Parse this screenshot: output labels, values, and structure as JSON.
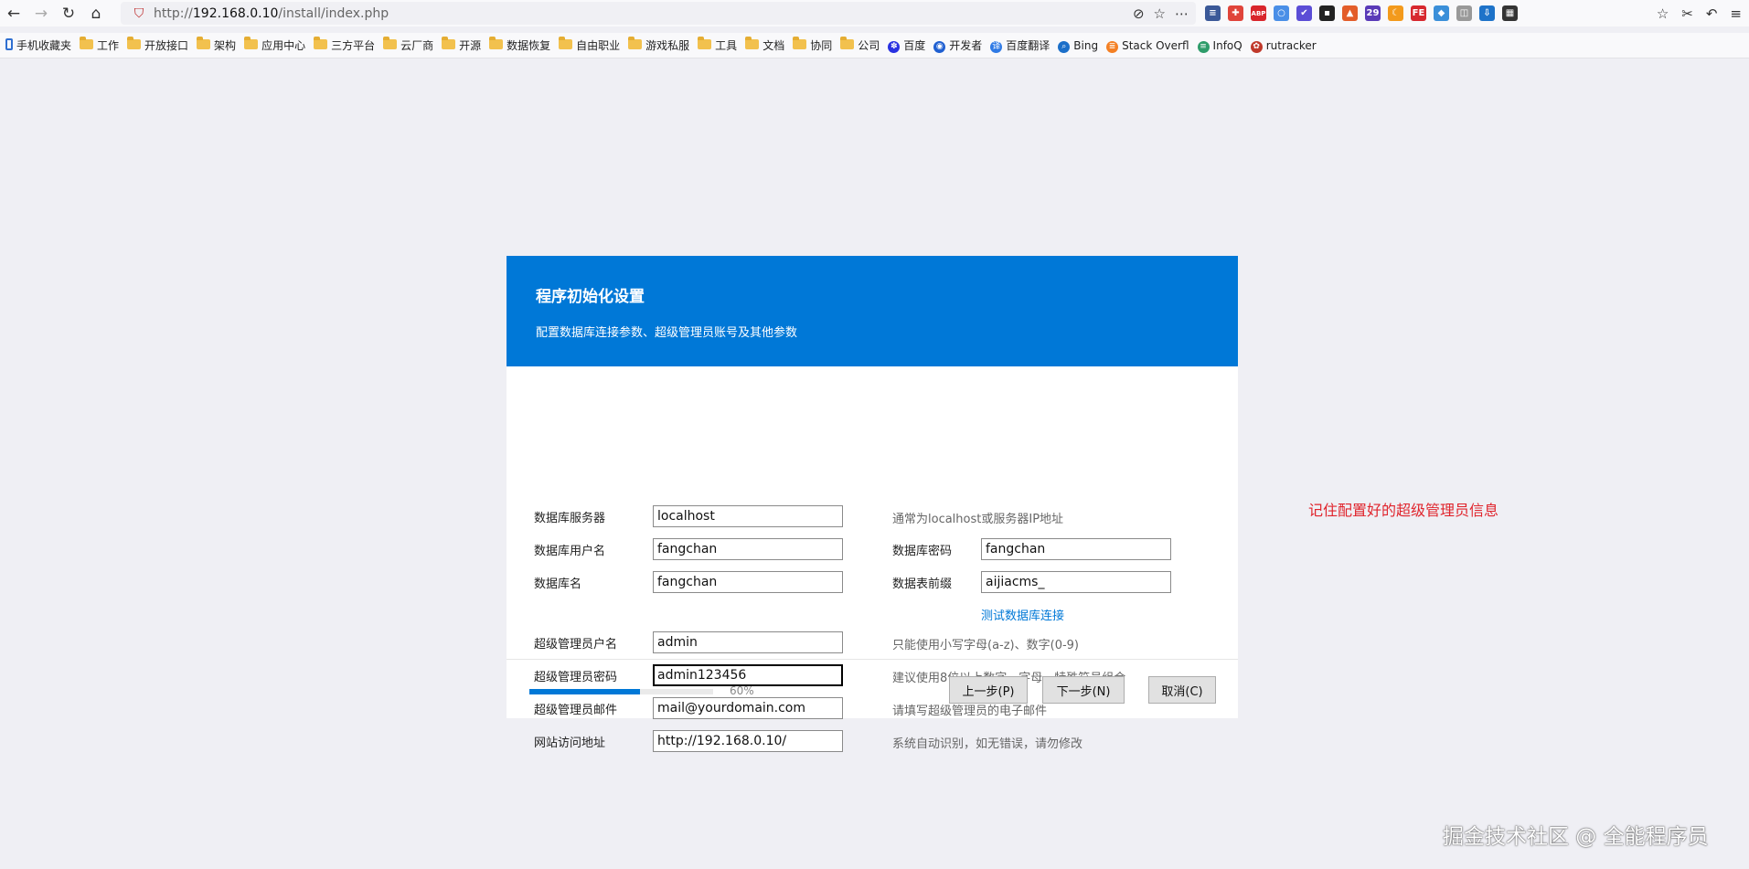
{
  "browser": {
    "url_prefix": "http://",
    "url_host": "192.168.0.10",
    "url_path": "/install/index.php",
    "extensions": [
      {
        "icon": "flag-icon",
        "color": "#3b5998",
        "glyph": "≡"
      },
      {
        "icon": "puzzle-icon",
        "color": "#e0443a",
        "glyph": "✚"
      },
      {
        "icon": "adblock-icon",
        "color": "#d9262c",
        "glyph": "ABP"
      },
      {
        "icon": "translate-icon",
        "color": "#4a8fe7",
        "glyph": "○"
      },
      {
        "icon": "check-icon",
        "color": "#5b4dd6",
        "glyph": "✔"
      },
      {
        "icon": "tool-icon",
        "color": "#222222",
        "glyph": "▪"
      },
      {
        "icon": "tree-icon",
        "color": "#e35d2a",
        "glyph": "▲"
      },
      {
        "icon": "badge-icon",
        "color": "#5a3ab8",
        "glyph": "29"
      },
      {
        "icon": "moon-icon",
        "color": "#f39a1c",
        "glyph": "☾"
      },
      {
        "icon": "fe-icon",
        "color": "#d7282f",
        "glyph": "FE"
      },
      {
        "icon": "shield-icon",
        "color": "#3a8fd9",
        "glyph": "◆"
      },
      {
        "icon": "reader-icon",
        "color": "#999999",
        "glyph": "◫"
      },
      {
        "icon": "save-icon",
        "color": "#1e73c9",
        "glyph": "⇩"
      },
      {
        "icon": "grid-icon",
        "color": "#333333",
        "glyph": "▦"
      }
    ]
  },
  "bookmarks": [
    {
      "label": "手机收藏夹",
      "icon": "phone-icon"
    },
    {
      "label": "工作",
      "icon": "folder-icon"
    },
    {
      "label": "开放接口",
      "icon": "folder-icon"
    },
    {
      "label": "架构",
      "icon": "folder-icon"
    },
    {
      "label": "应用中心",
      "icon": "folder-icon"
    },
    {
      "label": "三方平台",
      "icon": "folder-icon"
    },
    {
      "label": "云厂商",
      "icon": "folder-icon"
    },
    {
      "label": "开源",
      "icon": "folder-icon"
    },
    {
      "label": "数据恢复",
      "icon": "folder-icon"
    },
    {
      "label": "自由职业",
      "icon": "folder-icon"
    },
    {
      "label": "游戏私服",
      "icon": "folder-icon"
    },
    {
      "label": "工具",
      "icon": "folder-icon"
    },
    {
      "label": "文档",
      "icon": "folder-icon"
    },
    {
      "label": "协同",
      "icon": "folder-icon"
    },
    {
      "label": "公司",
      "icon": "folder-icon"
    },
    {
      "label": "百度",
      "icon": "baidu-icon"
    },
    {
      "label": "开发者",
      "icon": "dev-icon"
    },
    {
      "label": "百度翻译",
      "icon": "translate-icon"
    },
    {
      "label": "Bing",
      "icon": "search-icon"
    },
    {
      "label": "Stack Overfl",
      "icon": "stackoverflow-icon"
    },
    {
      "label": "InfoQ",
      "icon": "infoq-icon"
    },
    {
      "label": "rutracker",
      "icon": "rutracker-icon"
    }
  ],
  "dialog": {
    "title": "程序初始化设置",
    "subtitle": "配置数据库连接参数、超级管理员账号及其他参数",
    "fields": {
      "db_server": {
        "label": "数据库服务器",
        "value": "localhost",
        "hint": "通常为localhost或服务器IP地址"
      },
      "db_user": {
        "label": "数据库用户名",
        "value": "fangchan"
      },
      "db_password": {
        "label": "数据库密码",
        "value": "fangchan"
      },
      "db_name": {
        "label": "数据库名",
        "value": "fangchan"
      },
      "db_prefix": {
        "label": "数据表前缀",
        "value": "aijiacms_"
      },
      "admin_user": {
        "label": "超级管理员户名",
        "value": "admin",
        "hint": "只能使用小写字母(a-z)、数字(0-9)"
      },
      "admin_password": {
        "label": "超级管理员密码",
        "value": "admin123456",
        "hint": "建议使用8位以上数字、字母、特殊符号组合"
      },
      "admin_email": {
        "label": "超级管理员邮件",
        "value": "mail@yourdomain.com",
        "hint": "请填写超级管理员的电子邮件"
      },
      "site_url": {
        "label": "网站访问地址",
        "value": "http://192.168.0.10/",
        "hint": "系统自动识别，如无错误，请勿修改"
      }
    },
    "test_connection_label": "测试数据库连接",
    "progress": {
      "percent": 60,
      "text": "60%"
    },
    "buttons": {
      "prev": "上一步(P)",
      "next": "下一步(N)",
      "cancel": "取消(C)"
    }
  },
  "note": "记住配置好的超级管理员信息",
  "watermark": "掘金技术社区 @ 全能程序员"
}
